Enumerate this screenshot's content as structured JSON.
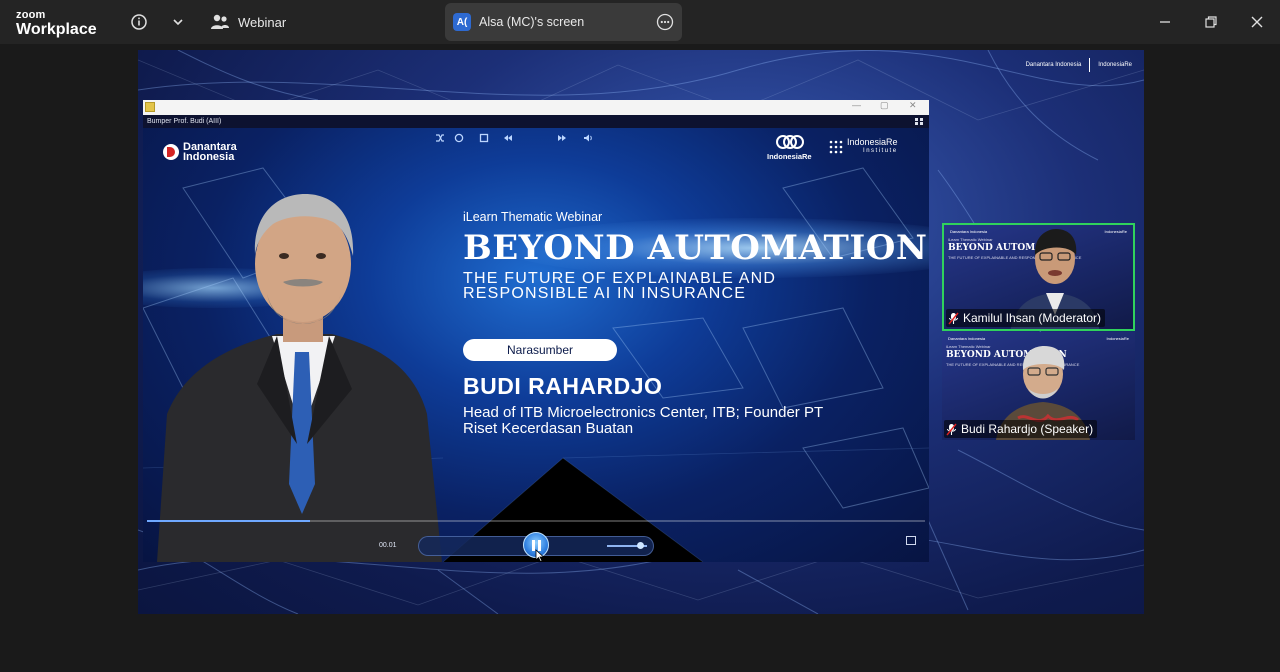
{
  "app": {
    "brand_top": "zoom",
    "brand_bottom": "Workplace",
    "webinar_label": "Webinar",
    "share_owner_initials": "A(",
    "share_label": "Alsa (MC)'s screen"
  },
  "player": {
    "window_title": "Bumper Prof. Budi (AIII)",
    "time": "00.01",
    "progress_fraction": 0.21
  },
  "slide": {
    "logo_left_line1": "Danantara",
    "logo_left_line2": "Indonesia",
    "logo_ir": "IndonesiaRe",
    "logo_iri_line1": "IndonesiaRe",
    "logo_iri_line2": "Institute",
    "series": "iLearn Thematic Webinar",
    "headline": "BEYOND AUTOMATION",
    "subheadline": "THE FUTURE OF EXPLAINABLE AND RESPONSIBLE AI IN INSURANCE",
    "pill": "Narasumber",
    "speaker_name": "BUDI RAHARDJO",
    "speaker_title": "Head of ITB Microelectronics Center, ITB; Founder PT Riset Kecerdasan Buatan"
  },
  "participants": [
    {
      "name": "Kamilul Ihsan (Moderator)",
      "active": true
    },
    {
      "name": "Budi Rahardjo (Speaker)",
      "active": false
    }
  ],
  "tile_slide": {
    "small": "iLearn Thematic Webinar",
    "title": "BEYOND AUTOMATION",
    "sub": "THE FUTURE OF EXPLAINABLE AND RESPONSIBLE AI IN INSURANCE",
    "logo_left": "Danantara Indonesia",
    "logo_right": "IndonesiaRe"
  },
  "colors": {
    "active_speaker_border": "#30d25c",
    "share_avatar": "#2e6ad1"
  }
}
